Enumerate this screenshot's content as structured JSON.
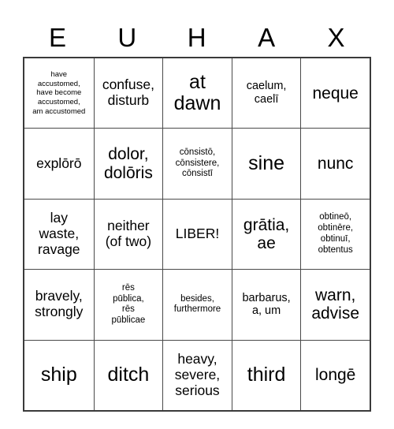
{
  "card": {
    "header_letters": [
      "E",
      "U",
      "H",
      "A",
      "X"
    ],
    "free_space_label": "LIBER!",
    "rows": [
      [
        {
          "text": "have\naccustomed,\nhave become\naccustomed,\nam accustomed",
          "size": "xs"
        },
        {
          "text": "confuse,\ndisturb",
          "size": "lg"
        },
        {
          "text": "at\ndawn",
          "size": "xxl"
        },
        {
          "text": "caelum,\ncaelī",
          "size": "md"
        },
        {
          "text": "neque",
          "size": "xl"
        }
      ],
      [
        {
          "text": "explōrō",
          "size": "lg"
        },
        {
          "text": "dolor,\ndolōris",
          "size": "xl"
        },
        {
          "text": "cōnsistō,\ncōnsistere,\ncōnsistī",
          "size": "sm"
        },
        {
          "text": "sine",
          "size": "xxl"
        },
        {
          "text": "nunc",
          "size": "xl"
        }
      ],
      [
        {
          "text": "lay\nwaste,\nravage",
          "size": "lg"
        },
        {
          "text": "neither\n(of two)",
          "size": "lg"
        },
        {
          "text": "LIBER!",
          "size": "lg"
        },
        {
          "text": "grātia,\nae",
          "size": "xl"
        },
        {
          "text": "obtineō,\nobtinēre,\nobtinuī,\nobtentus",
          "size": "sm"
        }
      ],
      [
        {
          "text": "bravely,\nstrongly",
          "size": "lg"
        },
        {
          "text": "rēs\npūblica,\nrēs\npūblicae",
          "size": "sm"
        },
        {
          "text": "besides,\nfurthermore",
          "size": "sm"
        },
        {
          "text": "barbarus,\na, um",
          "size": "md"
        },
        {
          "text": "warn,\nadvise",
          "size": "xl"
        }
      ],
      [
        {
          "text": "ship",
          "size": "xxl"
        },
        {
          "text": "ditch",
          "size": "xxl"
        },
        {
          "text": "heavy,\nsevere,\nserious",
          "size": "lg"
        },
        {
          "text": "third",
          "size": "xxl"
        },
        {
          "text": "longē",
          "size": "xl"
        }
      ]
    ]
  },
  "colors": {
    "background": "#ffffff",
    "text": "#000000",
    "grid_border": "#3a3a3a",
    "cell_border": "#4a4a4a"
  }
}
